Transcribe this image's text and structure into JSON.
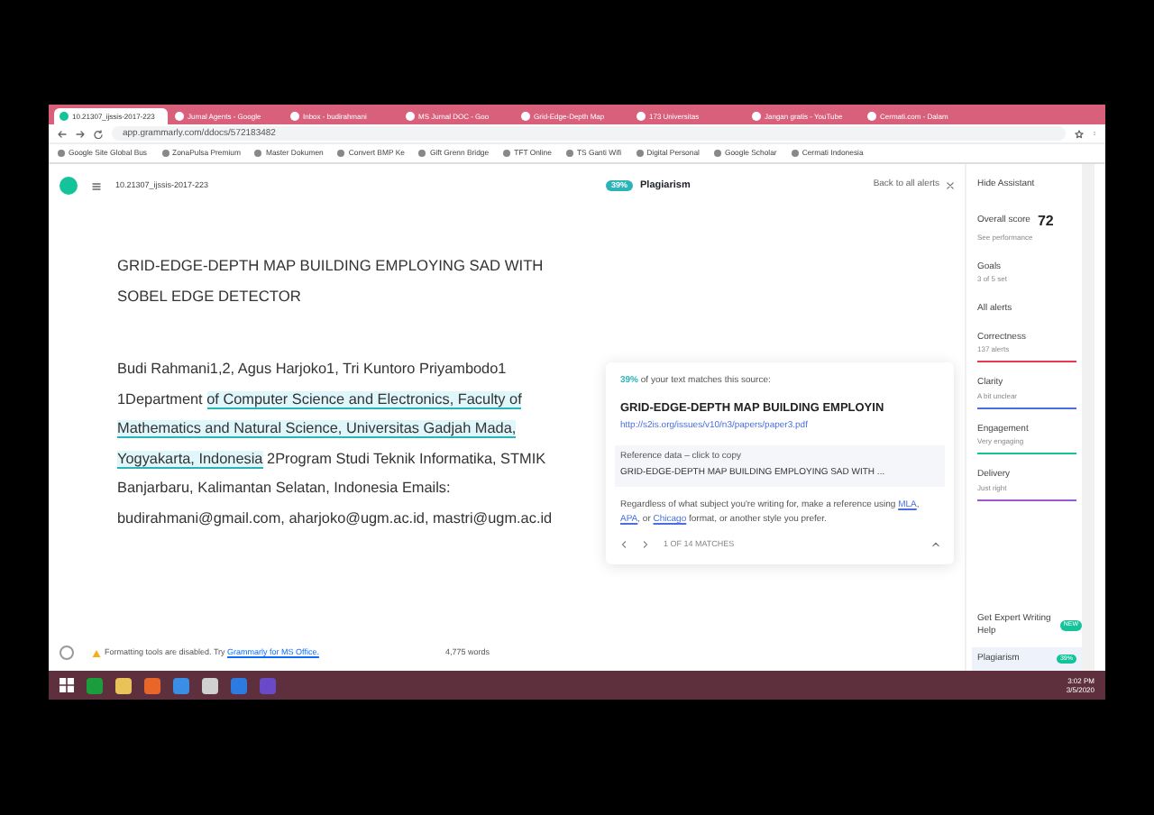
{
  "browser": {
    "tabs": [
      {
        "title": "10.21307_ijssis-2017-223",
        "selected": true
      },
      {
        "title": "Jurnal Agents - Google",
        "selected": false
      },
      {
        "title": "Inbox - budirahmani",
        "selected": false
      },
      {
        "title": "MS Jurnal DOC - Goo",
        "selected": false
      },
      {
        "title": "Grid-Edge-Depth Map",
        "selected": false
      },
      {
        "title": "173 Universitas",
        "selected": false
      },
      {
        "title": "Jangan gratis - YouTube",
        "selected": false
      },
      {
        "title": "Cermati.com - Dalam",
        "selected": false
      }
    ],
    "url": "app.grammarly.com/ddocs/572183482",
    "bookmarks": [
      "Google Site Global Bus",
      "ZonaPulsa Premium",
      "Master Dokumen",
      "Convert BMP Ke",
      "Gift Grenn Bridge",
      "TFT Online",
      "TS Ganti Wifi",
      "Digital Personal",
      "Google Scholar",
      "Cermati Indonesia"
    ]
  },
  "document": {
    "doc_id": "10.21307_ijssis-2017-223",
    "title": "GRID-EDGE-DEPTH MAP BUILDING EMPLOYING SAD WITH SOBEL EDGE DETECTOR",
    "body": [
      {
        "text": "Budi Rahmani1,2, Agus Harjoko1, Tri Kuntoro Priyambodo1 1Department ",
        "highlighted": false
      },
      {
        "text": "of Computer Science and Electronics, Faculty of Mathematics and Natural Science, Universitas Gadjah Mada, Yogyakarta, Indonesia",
        "highlighted": true
      },
      {
        "text": " 2Program Studi Teknik Informatika, STMIK Banjarbaru, Kalimantan Selatan, Indonesia Emails: budirahmani@gmail.com, aharjoko@ugm.ac.id, mastri@ugm.ac.id",
        "highlighted": false
      }
    ],
    "footer_notice": "Formatting tools are disabled. Try ",
    "footer_link": "Grammarly for MS Office.",
    "word_count": "4,775 words"
  },
  "plagiarism": {
    "badge": "39%",
    "title": "Plagiarism",
    "back_link": "Back to all alerts",
    "card": {
      "percent": "39%",
      "match_text": " of your text matches this source:",
      "source_title": "GRID-EDGE-DEPTH MAP BUILDING EMPLOYIN",
      "source_url": "http://s2is.org/issues/v10/n3/papers/paper3.pdf",
      "reference_label": "Reference data – click to copy",
      "reference_text": "GRID-EDGE-DEPTH MAP BUILDING EMPLOYING SAD WITH ...",
      "advice": [
        {
          "kind": "text",
          "text": "Regardless of what subject you're writing for, make a reference using "
        },
        {
          "kind": "link",
          "text": "MLA"
        },
        {
          "kind": "text",
          "text": ", "
        },
        {
          "kind": "link",
          "text": "APA"
        },
        {
          "kind": "text",
          "text": ", or "
        },
        {
          "kind": "link",
          "text": "Chicago"
        },
        {
          "kind": "text",
          "text": " format, or another style you prefer."
        }
      ],
      "pager": "1 OF 14 MATCHES"
    }
  },
  "sidebar": {
    "hide_label": "Hide Assistant",
    "score_label": "Overall score",
    "score": "72",
    "score_link": "See performance",
    "goals_label": "Goals",
    "goals_value": "3 of 5 set",
    "all_alerts": "All alerts",
    "categories": [
      {
        "name": "Correctness",
        "status": "137 alerts",
        "color": "#e8384f"
      },
      {
        "name": "Clarity",
        "status": "A bit unclear",
        "color": "#4a6ee0"
      },
      {
        "name": "Engagement",
        "status": "Very engaging",
        "color": "#15c39a"
      },
      {
        "name": "Delivery",
        "status": "Just right",
        "color": "#9b59d0"
      }
    ],
    "expert_label": "Get Expert Writing Help",
    "expert_badge": "NEW",
    "plagiarism_label": "Plagiarism",
    "plagiarism_badge": "39%"
  },
  "taskbar": {
    "time": "3:02 PM",
    "date": "3/5/2020"
  }
}
